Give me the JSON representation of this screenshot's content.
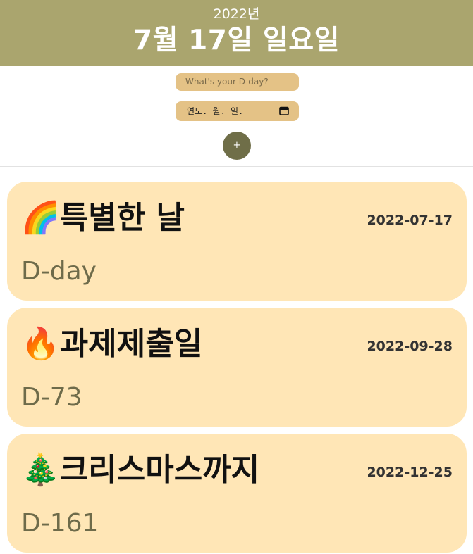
{
  "header": {
    "year": "2022년",
    "date": "7월 17일 일요일"
  },
  "form": {
    "dday_placeholder": "What's your D-day?",
    "date_placeholder": "연도. 월. 일.",
    "add_label": "+"
  },
  "colors": {
    "header_bg": "#aaa56e",
    "input_bg": "#e4c286",
    "button_bg": "#6f6e48",
    "card_bg": "#ffe6b6"
  },
  "items": [
    {
      "emoji": "🌈",
      "title": "특별한 날",
      "date": "2022-07-17",
      "dday": "D-day"
    },
    {
      "emoji": "🔥",
      "title": "과제제출일",
      "date": "2022-09-28",
      "dday": "D-73"
    },
    {
      "emoji": "🎄",
      "title": "크리스마스까지",
      "date": "2022-12-25",
      "dday": "D-161"
    }
  ]
}
